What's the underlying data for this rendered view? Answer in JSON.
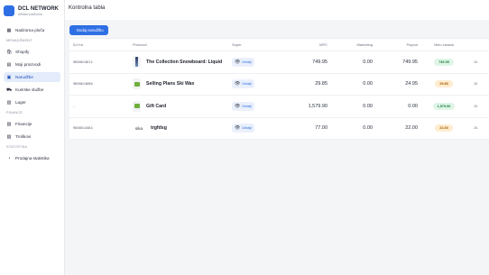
{
  "sidebar": {
    "brand_title": "DCL NETWORK",
    "brand_sub": "Affiliate platforma",
    "items_top": [
      {
        "label": "Nadzorna ploča",
        "icon": "dashboard-icon"
      }
    ],
    "section_management": "MENADŽMENT",
    "items_management": [
      {
        "label": "Shopify",
        "icon": "shopify-icon"
      },
      {
        "label": "Moji proizvodi",
        "icon": "products-icon"
      },
      {
        "label": "Narudžbe",
        "icon": "orders-icon",
        "active": true
      },
      {
        "label": "Kurirske službe",
        "icon": "courier-icon"
      },
      {
        "label": "Lager",
        "icon": "warehouse-icon"
      }
    ],
    "section_finance": "FINANCE",
    "items_finance": [
      {
        "label": "Financije",
        "icon": "finance-icon"
      },
      {
        "label": "Troškovi",
        "icon": "expenses-icon"
      }
    ],
    "section_stats": "STATISTIKA",
    "items_stats": [
      {
        "label": "Prodajna statistika",
        "icon": "stats-icon"
      }
    ]
  },
  "header": {
    "title": "Kontrolna tabla",
    "add_button": "Dodaj narudžbu"
  },
  "table": {
    "columns": [
      "Šifra",
      "Proizvod",
      "Super",
      "MPC",
      "Marketing",
      "Payout",
      "Neto zarada"
    ],
    "details_label": "Detalji",
    "rows": [
      {
        "sifra": "9858614612",
        "name": "The Collection Snowboard: Liquid",
        "thumb": "board",
        "mpc": "749.95",
        "marketing": "0.00",
        "payout": "749.95",
        "neto": "749.95",
        "neto_color": "green",
        "extra": "28."
      },
      {
        "sifra": "9858614680",
        "name": "Selling Plans Ski Wax",
        "thumb": "green",
        "mpc": "29.85",
        "marketing": "0.00",
        "payout": "24.95",
        "neto": "29.85",
        "neto_color": "orange",
        "extra": "28."
      },
      {
        "sifra": "-",
        "name": "Gift Card",
        "thumb": "green",
        "mpc": "1,579.90",
        "marketing": "0.00",
        "payout": "0.00",
        "neto": "1,579.90",
        "neto_color": "green",
        "extra": "28."
      },
      {
        "sifra": "9858614584",
        "name": "trgfdsg",
        "thumb": "text",
        "thumb_text": "sika",
        "mpc": "77.00",
        "marketing": "0.00",
        "payout": "22.00",
        "neto": "22.00",
        "neto_color": "orange",
        "extra": "28."
      }
    ]
  }
}
